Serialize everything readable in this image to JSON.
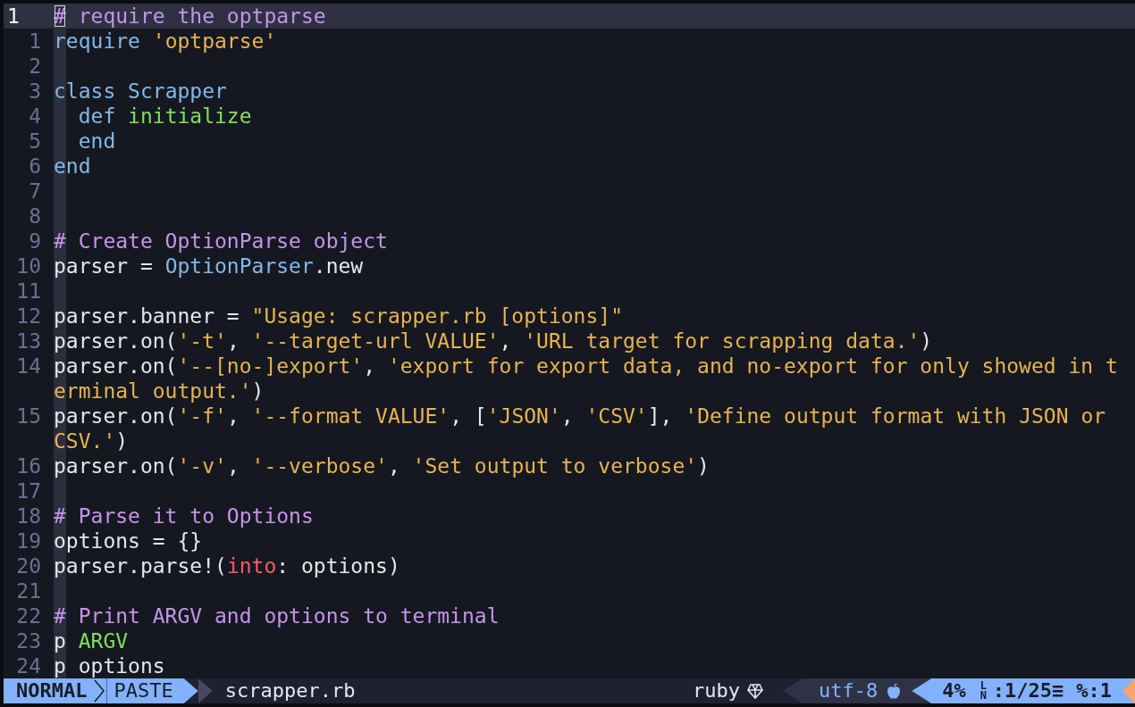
{
  "editor": {
    "lines": [
      {
        "number": "1",
        "cursor": true,
        "tokens": [
          {
            "kind": "comment",
            "text": "# require the optparse"
          }
        ]
      },
      {
        "number": "1",
        "cursor": false,
        "tokens": [
          {
            "kind": "keyword",
            "text": "require"
          },
          {
            "kind": "string",
            "text": " 'optparse'"
          }
        ]
      },
      {
        "number": "2",
        "cursor": false
      },
      {
        "number": "3",
        "cursor": false,
        "tokens": [
          {
            "kind": "keyword",
            "text": "class"
          },
          {
            "kind": "constant",
            "text": " Scrapper"
          }
        ]
      },
      {
        "number": "4",
        "cursor": false,
        "tokens": [
          {
            "kind": "keyword",
            "text": "  def"
          },
          {
            "kind": "function",
            "text": " initialize"
          }
        ]
      },
      {
        "number": "5",
        "cursor": false,
        "tokens": [
          {
            "kind": "keyword",
            "text": "  end"
          }
        ]
      },
      {
        "number": "6",
        "cursor": false,
        "tokens": [
          {
            "kind": "keyword",
            "text": "end"
          }
        ]
      },
      {
        "number": "7",
        "cursor": false
      },
      {
        "number": "8",
        "cursor": false
      },
      {
        "number": "9",
        "cursor": false,
        "tokens": [
          {
            "kind": "comment",
            "text": "# Create OptionParse object"
          }
        ]
      },
      {
        "number": "10",
        "cursor": false,
        "tokens": [
          {
            "kind": "plain",
            "text": "parser = "
          },
          {
            "kind": "constant",
            "text": "OptionParser"
          },
          {
            "kind": "plain",
            "text": ".new"
          }
        ]
      },
      {
        "number": "11",
        "cursor": false
      },
      {
        "number": "12",
        "cursor": false,
        "tokens": [
          {
            "kind": "plain",
            "text": "parser.banner = "
          },
          {
            "kind": "string",
            "text": "\"Usage: scrapper.rb [options]\""
          }
        ]
      },
      {
        "number": "13",
        "cursor": false,
        "tokens": [
          {
            "kind": "plain",
            "text": "parser.on("
          },
          {
            "kind": "string",
            "text": "'-t'"
          },
          {
            "kind": "plain",
            "text": ", "
          },
          {
            "kind": "string",
            "text": "'--target-url VALUE'"
          },
          {
            "kind": "plain",
            "text": ", "
          },
          {
            "kind": "string",
            "text": "'URL target for scrapping data.'"
          },
          {
            "kind": "plain",
            "text": ")"
          }
        ]
      },
      {
        "number": "14",
        "cursor": false,
        "tokens": [
          {
            "kind": "plain",
            "text": "parser.on("
          },
          {
            "kind": "string",
            "text": "'--[no-]export'"
          },
          {
            "kind": "plain",
            "text": ", "
          },
          {
            "kind": "string",
            "text": "'export for export data, and no-export for only showed in t"
          }
        ],
        "continuation": [
          {
            "kind": "string",
            "text": "erminal output.'"
          },
          {
            "kind": "plain",
            "text": ")"
          }
        ]
      },
      {
        "number": "15",
        "cursor": false,
        "tokens": [
          {
            "kind": "plain",
            "text": "parser.on("
          },
          {
            "kind": "string",
            "text": "'-f'"
          },
          {
            "kind": "plain",
            "text": ", "
          },
          {
            "kind": "string",
            "text": "'--format VALUE'"
          },
          {
            "kind": "plain",
            "text": ", ["
          },
          {
            "kind": "string",
            "text": "'JSON'"
          },
          {
            "kind": "plain",
            "text": ", "
          },
          {
            "kind": "string",
            "text": "'CSV'"
          },
          {
            "kind": "plain",
            "text": "], "
          },
          {
            "kind": "string",
            "text": "'Define output format with JSON or"
          }
        ],
        "continuation": [
          {
            "kind": "string",
            "text": "CSV.'"
          },
          {
            "kind": "plain",
            "text": ")"
          }
        ]
      },
      {
        "number": "16",
        "cursor": false,
        "tokens": [
          {
            "kind": "plain",
            "text": "parser.on("
          },
          {
            "kind": "string",
            "text": "'-v'"
          },
          {
            "kind": "plain",
            "text": ", "
          },
          {
            "kind": "string",
            "text": "'--verbose'"
          },
          {
            "kind": "plain",
            "text": ", "
          },
          {
            "kind": "string",
            "text": "'Set output to verbose'"
          },
          {
            "kind": "plain",
            "text": ")"
          }
        ]
      },
      {
        "number": "17",
        "cursor": false
      },
      {
        "number": "18",
        "cursor": false,
        "tokens": [
          {
            "kind": "comment",
            "text": "# Parse it to Options"
          }
        ]
      },
      {
        "number": "19",
        "cursor": false,
        "tokens": [
          {
            "kind": "plain",
            "text": "options = {}"
          }
        ]
      },
      {
        "number": "20",
        "cursor": false,
        "tokens": [
          {
            "kind": "plain",
            "text": "parser.parse!("
          },
          {
            "kind": "symbol",
            "text": "into"
          },
          {
            "kind": "plain",
            "text": ": options)"
          }
        ]
      },
      {
        "number": "21",
        "cursor": false
      },
      {
        "number": "22",
        "cursor": false,
        "tokens": [
          {
            "kind": "comment",
            "text": "# Print ARGV and options to terminal"
          }
        ]
      },
      {
        "number": "23",
        "cursor": false,
        "tokens": [
          {
            "kind": "plain",
            "text": "p "
          },
          {
            "kind": "function",
            "text": "ARGV"
          }
        ]
      },
      {
        "number": "24",
        "cursor": false,
        "tokens": [
          {
            "kind": "plain",
            "text": "p options"
          }
        ]
      }
    ]
  },
  "status_bar": {
    "mode": "NORMAL",
    "paste": "PASTE",
    "filename": "scrapper.rb",
    "filetype": "ruby",
    "encoding": "utf-8",
    "percent": "4%",
    "line_symbol": "LN",
    "position": ":1/25≡",
    "column": "%:1"
  }
}
